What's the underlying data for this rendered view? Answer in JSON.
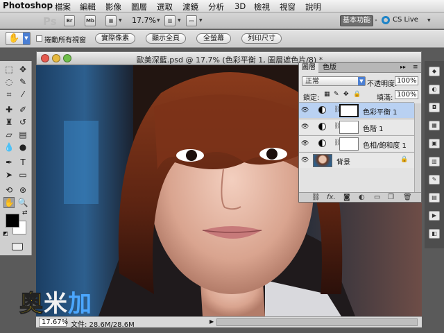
{
  "menubar": {
    "apple": "",
    "app_name": "Photoshop",
    "items": [
      "檔案",
      "編輯",
      "影像",
      "圖層",
      "選取",
      "濾鏡",
      "分析",
      "3D",
      "檢視",
      "視窗",
      "說明"
    ]
  },
  "appbar": {
    "logo": "Ps",
    "bridge": "Br",
    "minibridge": "Mb",
    "zoom": "17.7%",
    "workspace": "基本功能",
    "cs_live": "CS Live"
  },
  "options": {
    "scroll_all_windows": "捲動所有視窗",
    "buttons": [
      "實際像素",
      "顯示全頁",
      "全螢幕",
      "列印尺寸"
    ]
  },
  "document": {
    "title": "歐美深藍.psd @ 17.7% (色彩平衡 1, 圖層遮色片/8) *",
    "zoom": "17.67%",
    "size": "文件: 28.6M/28.6M"
  },
  "layers_panel": {
    "tabs": [
      "圖層",
      "色版"
    ],
    "blend_mode": "正常",
    "opacity_label": "不透明度:",
    "opacity": "100%",
    "lock_label": "鎖定:",
    "fill_label": "填滿:",
    "fill": "100%",
    "layers": [
      {
        "name": "色彩平衡 1",
        "selected": true
      },
      {
        "name": "色階 1",
        "selected": false
      },
      {
        "name": "色相/飽和度 1",
        "selected": false
      },
      {
        "name": "背景",
        "selected": false
      }
    ]
  },
  "watermark": {
    "text": "奧米加"
  },
  "colors": {
    "selection": "#b9d1f2",
    "accent": "#4b7fd3",
    "cs_live": "#1d84c8"
  }
}
